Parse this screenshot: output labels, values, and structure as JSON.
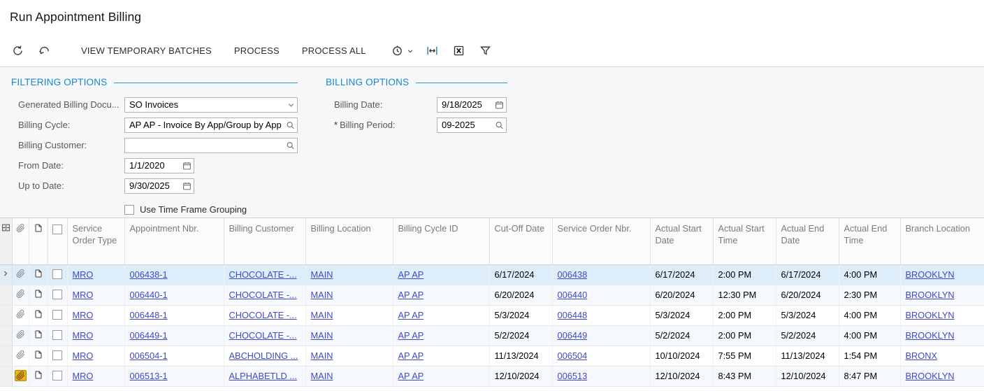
{
  "page": {
    "title": "Run Appointment Billing"
  },
  "toolbar": {
    "icons": [
      "refresh-icon",
      "undo-icon",
      "schedule-icon",
      "chevron-down-icon",
      "fit-width-icon",
      "export-excel-icon",
      "filter-icon"
    ],
    "buttons": {
      "view_temporary_batches": "VIEW TEMPORARY BATCHES",
      "process": "PROCESS",
      "process_all": "PROCESS ALL"
    }
  },
  "filtering_options": {
    "title": "FILTERING OPTIONS",
    "fields": [
      {
        "label": "Generated Billing Docu...",
        "value": "SO Invoices",
        "control": "dropdown",
        "icon": "chevron-down-icon"
      },
      {
        "label": "Billing Cycle:",
        "value": "AP AP - Invoice By App/Group by App",
        "control": "lookup",
        "icon": "search-icon"
      },
      {
        "label": "Billing Customer:",
        "value": "",
        "control": "lookup",
        "icon": "search-icon"
      },
      {
        "label": "From Date:",
        "value": "1/1/2020",
        "control": "date",
        "icon": "calendar-icon"
      },
      {
        "label": "Up to Date:",
        "value": "9/30/2025",
        "control": "date",
        "icon": "calendar-icon"
      }
    ],
    "use_time_frame_grouping": {
      "label": "Use Time Frame Grouping",
      "checked": false
    }
  },
  "billing_options": {
    "title": "BILLING OPTIONS",
    "fields": [
      {
        "label": "Billing Date:",
        "value": "9/18/2025",
        "control": "date",
        "icon": "calendar-icon",
        "required": false,
        "required_marker": ""
      },
      {
        "label": "Billing Period:",
        "value": "09-2025",
        "control": "lookup",
        "icon": "search-icon",
        "required": true,
        "required_marker": "*"
      }
    ]
  },
  "grid": {
    "header_icons": [
      "grid-tools-icon",
      "paperclip-icon",
      "note-icon",
      "select-all-checkbox"
    ],
    "columns": [
      {
        "key": "service_order_type",
        "label": "Service Order Type",
        "type": "link"
      },
      {
        "key": "appointment_nbr",
        "label": "Appointment Nbr.",
        "type": "link"
      },
      {
        "key": "billing_customer",
        "label": "Billing Customer",
        "type": "link"
      },
      {
        "key": "billing_location",
        "label": "Billing Location",
        "type": "link"
      },
      {
        "key": "billing_cycle_id",
        "label": "Billing Cycle ID",
        "type": "link"
      },
      {
        "key": "cut_off_date",
        "label": "Cut-Off Date",
        "type": "text"
      },
      {
        "key": "service_order_nbr",
        "label": "Service Order Nbr.",
        "type": "link"
      },
      {
        "key": "actual_start_date",
        "label": "Actual Start Date",
        "type": "text"
      },
      {
        "key": "actual_start_time",
        "label": "Actual Start Time",
        "type": "text"
      },
      {
        "key": "actual_end_date",
        "label": "Actual End Date",
        "type": "text"
      },
      {
        "key": "actual_end_time",
        "label": "Actual End Time",
        "type": "text"
      },
      {
        "key": "branch_location",
        "label": "Branch Location",
        "type": "link"
      }
    ],
    "rows": [
      {
        "current": true,
        "selected": true,
        "checked": false,
        "attachment_files": false,
        "service_order_type": "MRO",
        "appointment_nbr": "006438-1",
        "billing_customer": "CHOCOLATE -...",
        "billing_location": "MAIN",
        "billing_cycle_id": "AP AP",
        "cut_off_date": "6/17/2024",
        "service_order_nbr": "006438",
        "actual_start_date": "6/17/2024",
        "actual_start_time": "2:00 PM",
        "actual_end_date": "6/17/2024",
        "actual_end_time": "4:00 PM",
        "branch_location": "BROOKLYN"
      },
      {
        "current": false,
        "selected": false,
        "checked": false,
        "attachment_files": false,
        "service_order_type": "MRO",
        "appointment_nbr": "006440-1",
        "billing_customer": "CHOCOLATE -...",
        "billing_location": "MAIN",
        "billing_cycle_id": "AP AP",
        "cut_off_date": "6/20/2024",
        "service_order_nbr": "006440",
        "actual_start_date": "6/20/2024",
        "actual_start_time": "12:30 PM",
        "actual_end_date": "6/20/2024",
        "actual_end_time": "2:30 PM",
        "branch_location": "BROOKLYN"
      },
      {
        "current": false,
        "selected": false,
        "checked": false,
        "attachment_files": false,
        "service_order_type": "MRO",
        "appointment_nbr": "006448-1",
        "billing_customer": "CHOCOLATE -...",
        "billing_location": "MAIN",
        "billing_cycle_id": "AP AP",
        "cut_off_date": "5/3/2024",
        "service_order_nbr": "006448",
        "actual_start_date": "5/3/2024",
        "actual_start_time": "2:00 PM",
        "actual_end_date": "5/3/2024",
        "actual_end_time": "4:00 PM",
        "branch_location": "BROOKLYN"
      },
      {
        "current": false,
        "selected": false,
        "checked": false,
        "attachment_files": false,
        "service_order_type": "MRO",
        "appointment_nbr": "006449-1",
        "billing_customer": "CHOCOLATE -...",
        "billing_location": "MAIN",
        "billing_cycle_id": "AP AP",
        "cut_off_date": "5/2/2024",
        "service_order_nbr": "006449",
        "actual_start_date": "5/2/2024",
        "actual_start_time": "2:00 PM",
        "actual_end_date": "5/2/2024",
        "actual_end_time": "4:00 PM",
        "branch_location": "BROOKLYN"
      },
      {
        "current": false,
        "selected": false,
        "checked": false,
        "attachment_files": false,
        "service_order_type": "MRO",
        "appointment_nbr": "006504-1",
        "billing_customer": "ABCHOLDING ...",
        "billing_location": "MAIN",
        "billing_cycle_id": "AP AP",
        "cut_off_date": "11/13/2024",
        "service_order_nbr": "006504",
        "actual_start_date": "10/10/2024",
        "actual_start_time": "7:55 PM",
        "actual_end_date": "11/13/2024",
        "actual_end_time": "1:54 PM",
        "branch_location": "BRONX"
      },
      {
        "current": false,
        "selected": false,
        "checked": false,
        "attachment_files": true,
        "service_order_type": "MRO",
        "appointment_nbr": "006513-1",
        "billing_customer": "ALPHABETLD ...",
        "billing_location": "MAIN",
        "billing_cycle_id": "AP AP",
        "cut_off_date": "12/10/2024",
        "service_order_nbr": "006513",
        "actual_start_date": "12/10/2024",
        "actual_start_time": "8:43 PM",
        "actual_end_date": "12/10/2024",
        "actual_end_time": "8:47 PM",
        "branch_location": "BROOKLYN"
      }
    ]
  },
  "colors": {
    "section_header_blue": "#1a87c9",
    "link_blue": "#3f49c9",
    "selected_row_bg": "#ddeefa",
    "attachment_gold": "#efaf15",
    "panel_bg": "#f6f7f8"
  }
}
